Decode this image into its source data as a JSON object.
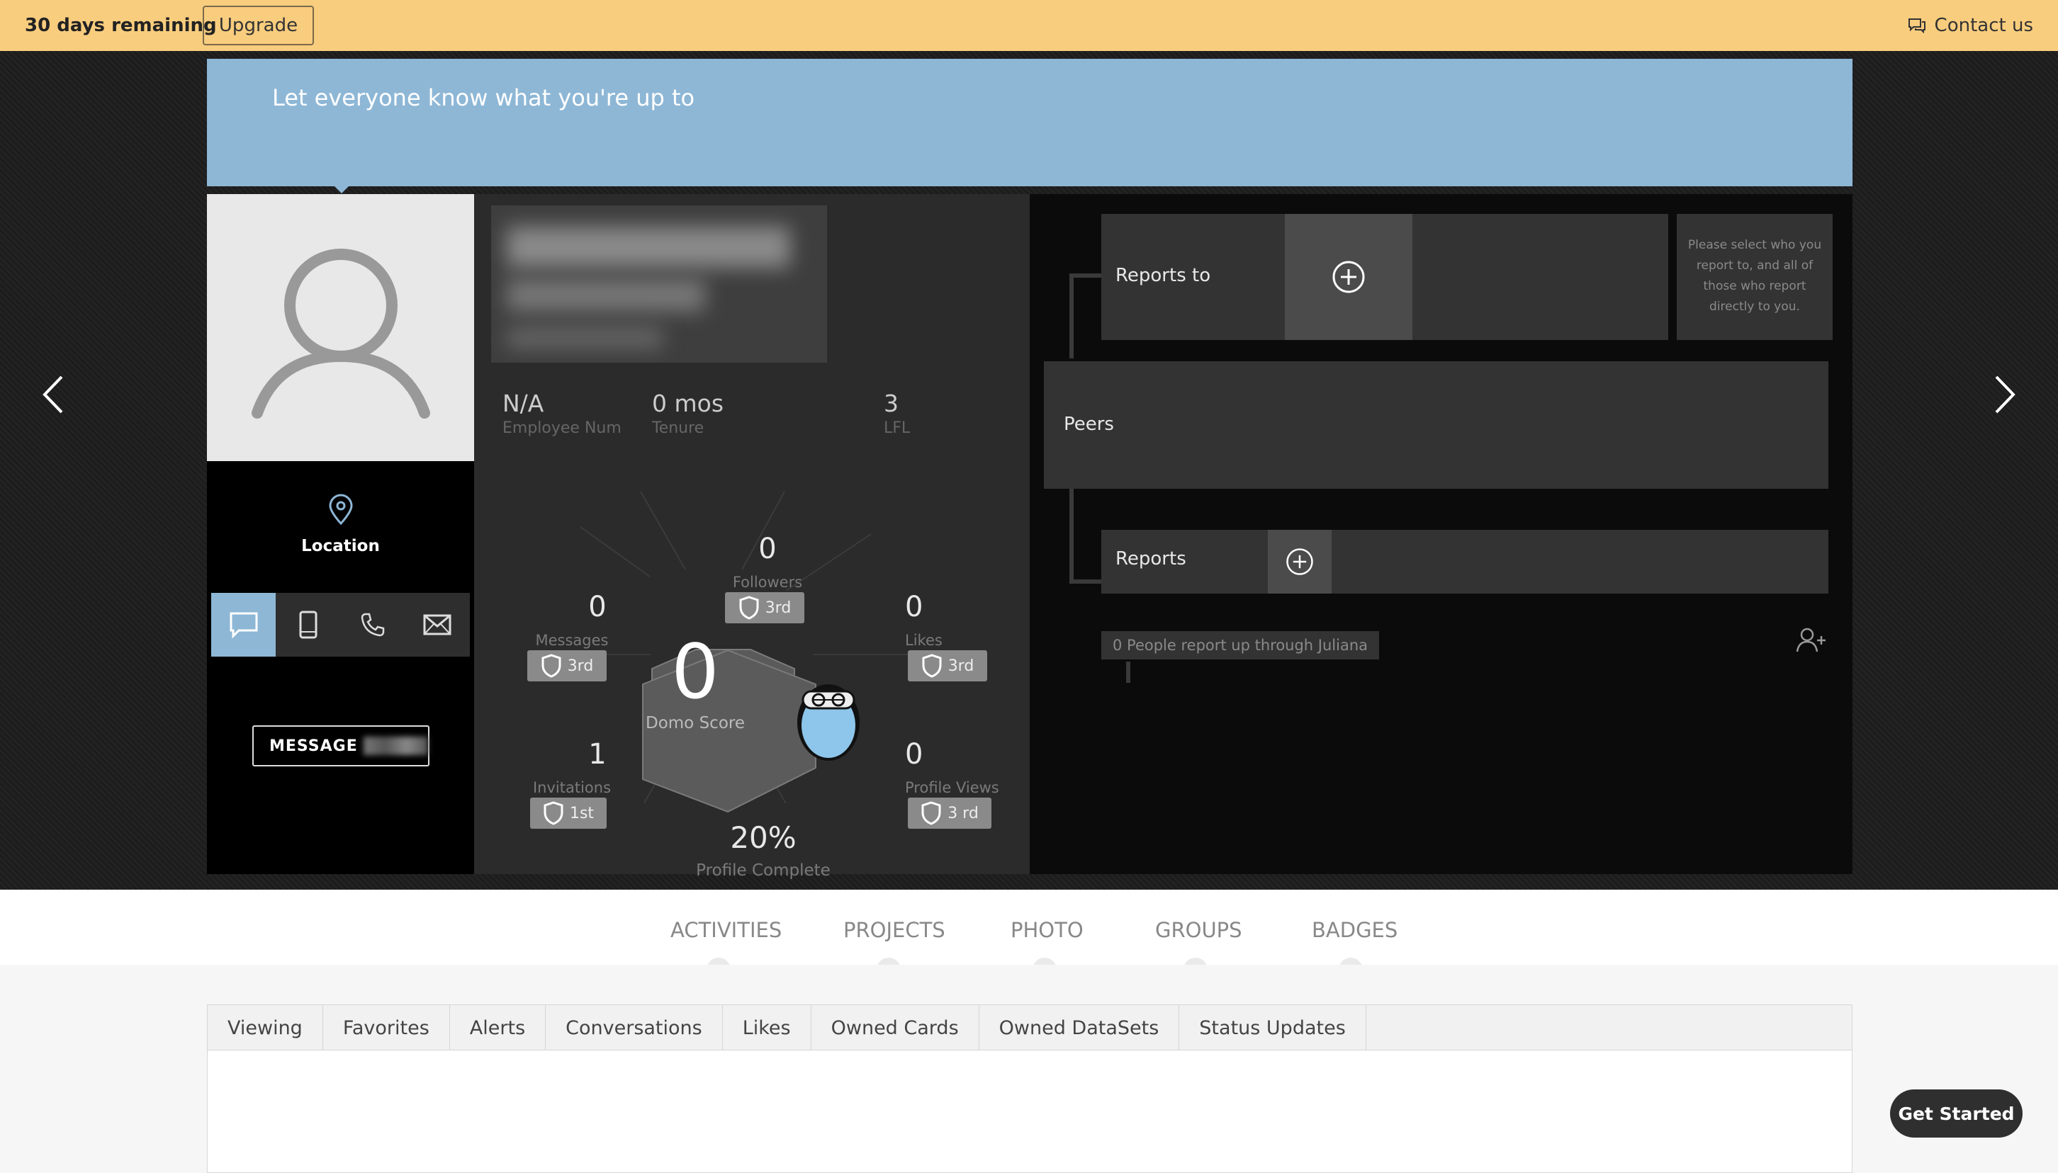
{
  "trial": {
    "days_remaining": "30 days remaining",
    "upgrade_label": "Upgrade",
    "contact_label": "Contact us"
  },
  "status": {
    "placeholder": "Let everyone know what you're up to"
  },
  "profile": {
    "location_label": "Location",
    "message_button": "MESSAGE",
    "employee_num_value": "N/A",
    "employee_num_label": "Employee Num",
    "tenure_value": "0 mos",
    "tenure_label": "Tenure",
    "lfl_value": "3",
    "lfl_label": "LFL"
  },
  "metrics": {
    "followers": {
      "value": "0",
      "label": "Followers",
      "rank": "3rd"
    },
    "messages": {
      "value": "0",
      "label": "Messages",
      "rank": "3rd"
    },
    "likes": {
      "value": "0",
      "label": "Likes",
      "rank": "3rd"
    },
    "invitations": {
      "value": "1",
      "label": "Invitations",
      "rank": "1st"
    },
    "profile_views": {
      "value": "0",
      "label": "Profile Views",
      "rank": "3 rd"
    },
    "domo_score": {
      "value": "0",
      "label": "Domo Score"
    },
    "profile_complete": {
      "value": "20%",
      "label": "Profile Complete",
      "progress_fraction": 0.2
    }
  },
  "org": {
    "reports_to_label": "Reports to",
    "hint": "Please select who you report to, and all of those who report directly to you.",
    "peers_label": "Peers",
    "reports_label": "Reports",
    "report_count": "0 People report up through Juliana"
  },
  "tabs": [
    "ACTIVITIES",
    "PROJECTS",
    "PHOTO",
    "GROUPS",
    "BADGES"
  ],
  "subtabs": [
    "Viewing",
    "Favorites",
    "Alerts",
    "Conversations",
    "Likes",
    "Owned Cards",
    "Owned DataSets",
    "Status Updates"
  ],
  "get_started": "Get Started",
  "colors": {
    "banner": "#f9cd7e",
    "status_bar": "#8eb7d6",
    "active_contact": "#8eb7d6"
  }
}
